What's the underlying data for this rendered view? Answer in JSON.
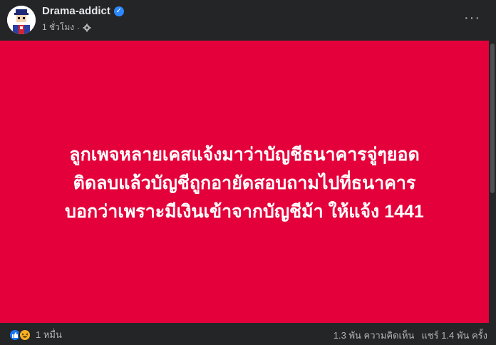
{
  "header": {
    "page_name": "Drama-addict",
    "time_ago": "1 ชั่วโมง",
    "separator": "·",
    "more_label": "···"
  },
  "post": {
    "background": "#e4003a",
    "lines": [
      "ลูกเพจหลายเคสแจ้งมาว่าบัญชีธนาคารจู่ๆยอด",
      "ติดลบแล้วบัญชีถูกอายัดสอบถามไปที่ธนาคาร",
      "บอกว่าเพราะมีเงินเข้าจากบัญชีม้า ให้แจ้ง 1441"
    ]
  },
  "footer": {
    "reaction_count": "1 หมื่น",
    "comments": "1.3 พัน ความคิดเห็น",
    "shares": "แชร์ 1.4 พัน ครั้ง"
  },
  "icons": {
    "verified": "verified-badge-icon",
    "audience": "gear-icon",
    "like": "like-reaction-icon",
    "haha": "haha-reaction-icon"
  }
}
